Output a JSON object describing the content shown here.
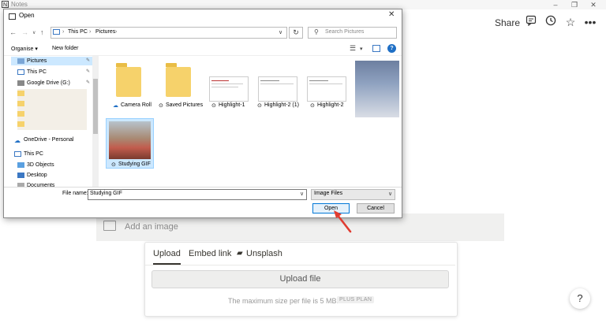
{
  "notes_app": {
    "window_title": "Notes",
    "logo": "N",
    "share_label": "Share",
    "header_icons": [
      "comment-icon",
      "clock-icon",
      "star-icon",
      "more-icon"
    ],
    "add_image_label": "Add an image",
    "upload_tabs": [
      {
        "label": "Upload",
        "active": true
      },
      {
        "label": "Embed link"
      },
      {
        "label": "Unsplash"
      }
    ],
    "upload_button": "Upload file",
    "max_size_text": "The maximum size per file is 5 MB.",
    "plan_badge": "PLUS PLAN",
    "help_label": "?"
  },
  "dialog": {
    "title": "Open",
    "breadcrumb": [
      "This PC",
      "Pictures"
    ],
    "search_placeholder": "Search Pictures",
    "organise_label": "Organise ▾",
    "new_folder_label": "New folder",
    "nav_items": {
      "pictures": "Pictures",
      "this_pc_quick": "This PC",
      "google_drive": "Google Drive (G:)",
      "onedrive": "OneDrive - Personal",
      "this_pc": "This PC",
      "objects_3d": "3D Objects",
      "desktop": "Desktop",
      "documents": "Documents"
    },
    "files": [
      {
        "name": "Camera Roll",
        "kind": "folder"
      },
      {
        "name": "Saved Pictures",
        "kind": "folder"
      },
      {
        "name": "Highlight-1",
        "kind": "image"
      },
      {
        "name": "Highlight-2 (1)",
        "kind": "image"
      },
      {
        "name": "Highlight-2",
        "kind": "image"
      },
      {
        "name": "Studying GIF",
        "kind": "gif",
        "selected": true
      }
    ],
    "file_name_label": "File name:",
    "file_name_value": "Studying GIF",
    "file_type_value": "Image Files",
    "open_button": "Open",
    "cancel_button": "Cancel"
  },
  "colors": {
    "selection": "#cce8ff",
    "accent_blue": "#0078d7",
    "arrow_red": "#e03c31",
    "folder_yellow": "#f6d26b"
  }
}
